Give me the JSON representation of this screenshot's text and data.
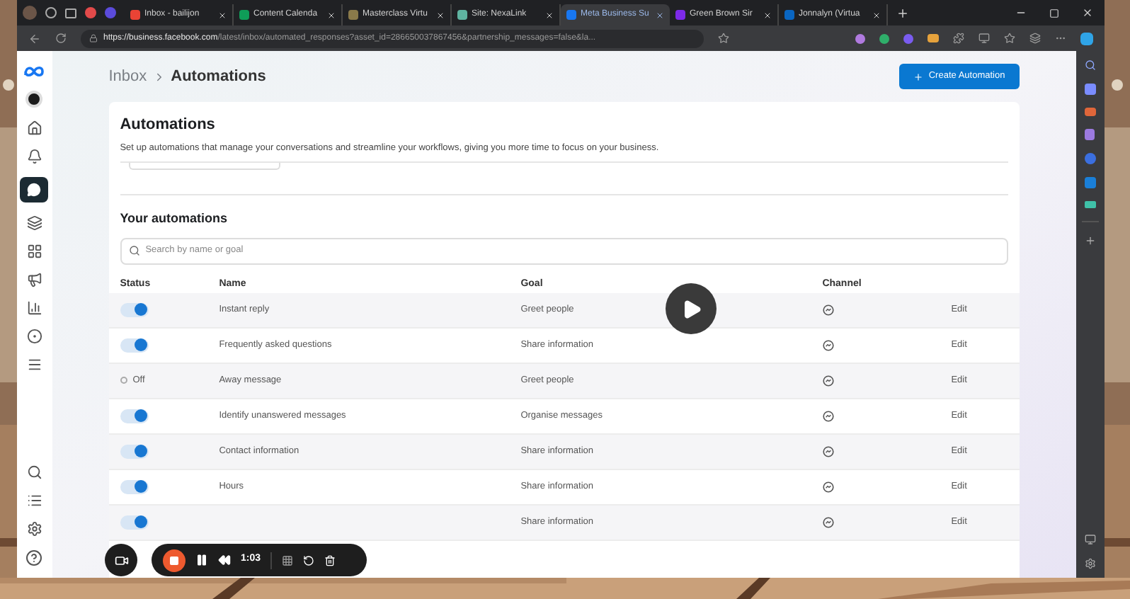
{
  "browser": {
    "tabs": [
      {
        "title": "Inbox - bailijon",
        "selected": false
      },
      {
        "title": "Content Calenda",
        "selected": false
      },
      {
        "title": "Masterclass Virtu",
        "selected": false
      },
      {
        "title": "Site: NexaLink",
        "selected": false
      },
      {
        "title": "Meta Business Su",
        "selected": true
      },
      {
        "title": "Green Brown Sir",
        "selected": false
      },
      {
        "title": "Jonnalyn (Virtua",
        "selected": false
      }
    ],
    "url_host": "https://business.facebook.com",
    "url_path": "/latest/inbox/automated_responses?asset_id=286650037867456&partnership_messages=false&la..."
  },
  "breadcrumb": {
    "parent": "Inbox",
    "current": "Automations"
  },
  "create_button": "Create Automation",
  "card": {
    "title": "Automations",
    "description": "Set up automations that manage your conversations and streamline your workflows, giving you more time to focus on your business."
  },
  "your_automations": {
    "title": "Your automations",
    "search": {
      "placeholder": "Search by name or goal"
    },
    "columns": [
      "Status",
      "Name",
      "Goal",
      "Channel"
    ],
    "rows": [
      {
        "on": true,
        "name": "Instant reply",
        "goal": "Greet people",
        "action": "Edit"
      },
      {
        "on": true,
        "name": "Frequently asked questions",
        "goal": "Share information",
        "action": "Edit"
      },
      {
        "on": false,
        "status_text": "Off",
        "name": "Away message",
        "goal": "Greet people",
        "action": "Edit"
      },
      {
        "on": true,
        "name": "Identify unanswered messages",
        "goal": "Organise messages",
        "action": "Edit"
      },
      {
        "on": true,
        "name": "Contact information",
        "goal": "Share information",
        "action": "Edit"
      },
      {
        "on": true,
        "name": "Hours",
        "goal": "Share information",
        "action": "Edit"
      },
      {
        "on": true,
        "goal": "Share information",
        "action": "Edit"
      }
    ]
  },
  "recorder": {
    "time": "1:03"
  }
}
